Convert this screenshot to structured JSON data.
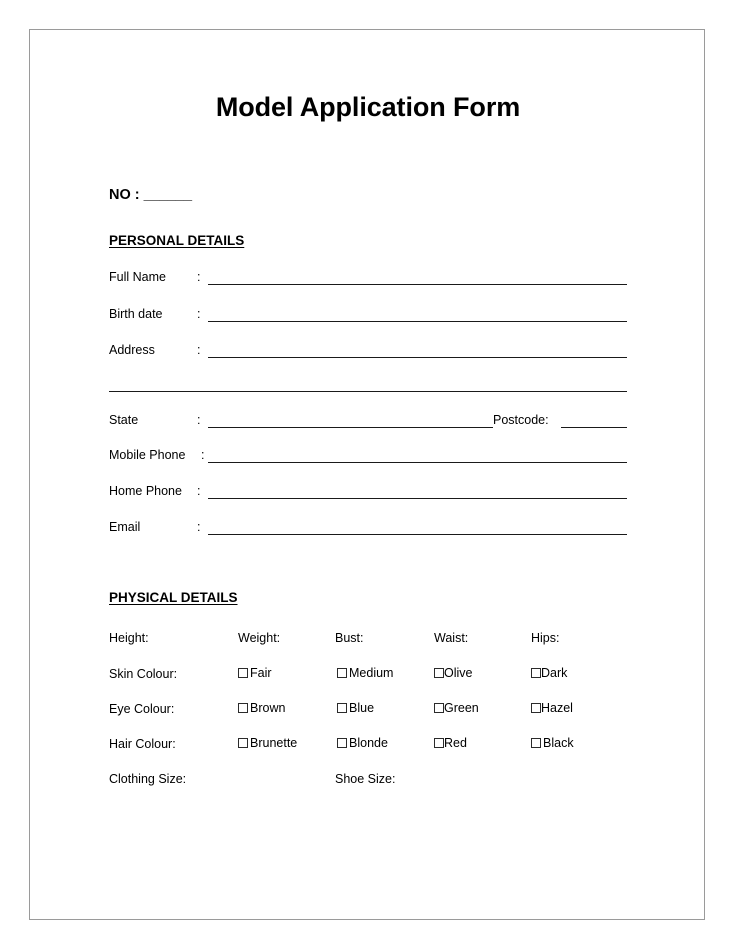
{
  "document": {
    "title": "Model Application Form",
    "reference": {
      "label": "NO :",
      "blank": "______"
    }
  },
  "personal_details": {
    "heading": "PERSONAL DETAILS",
    "separator": ":",
    "fields": [
      {
        "label": "Full Name",
        "value": ""
      },
      {
        "label": "Birth date",
        "value": ""
      },
      {
        "label": "Address",
        "value": ""
      },
      {
        "label": "State",
        "value": ""
      },
      {
        "label": "Mobile Phone",
        "value": ""
      },
      {
        "label": "Home Phone",
        "value": ""
      },
      {
        "label": "Email",
        "value": ""
      }
    ],
    "postcode": {
      "label": "Postcode:",
      "value": ""
    }
  },
  "physical_details": {
    "heading": "PHYSICAL DETAILS",
    "measurements": [
      {
        "label": "Height:",
        "value": ""
      },
      {
        "label": "Weight:",
        "value": ""
      },
      {
        "label": "Bust:",
        "value": ""
      },
      {
        "label": "Waist:",
        "value": ""
      },
      {
        "label": "Hips:",
        "value": ""
      }
    ],
    "choice_rows": [
      {
        "label": "Skin Colour:",
        "options": [
          {
            "label": "Fair",
            "checked": false
          },
          {
            "label": "Medium",
            "checked": false
          },
          {
            "label": "Olive",
            "checked": false
          },
          {
            "label": "Dark",
            "checked": false
          }
        ]
      },
      {
        "label": "Eye Colour:",
        "options": [
          {
            "label": "Brown",
            "checked": false
          },
          {
            "label": "Blue",
            "checked": false
          },
          {
            "label": "Green",
            "checked": false
          },
          {
            "label": "Hazel",
            "checked": false
          }
        ]
      },
      {
        "label": "Hair Colour:",
        "options": [
          {
            "label": "Brunette",
            "checked": false
          },
          {
            "label": "Blonde",
            "checked": false
          },
          {
            "label": "Red",
            "checked": false
          },
          {
            "label": "Black",
            "checked": false
          }
        ]
      }
    ],
    "sizes": [
      {
        "label": "Clothing Size:",
        "value": ""
      },
      {
        "label": "Shoe Size:",
        "value": ""
      }
    ]
  },
  "colors": {
    "page_border": "#9a9a9a",
    "rule": "#1a1a1a",
    "text": "#000000",
    "background": "#ffffff"
  }
}
